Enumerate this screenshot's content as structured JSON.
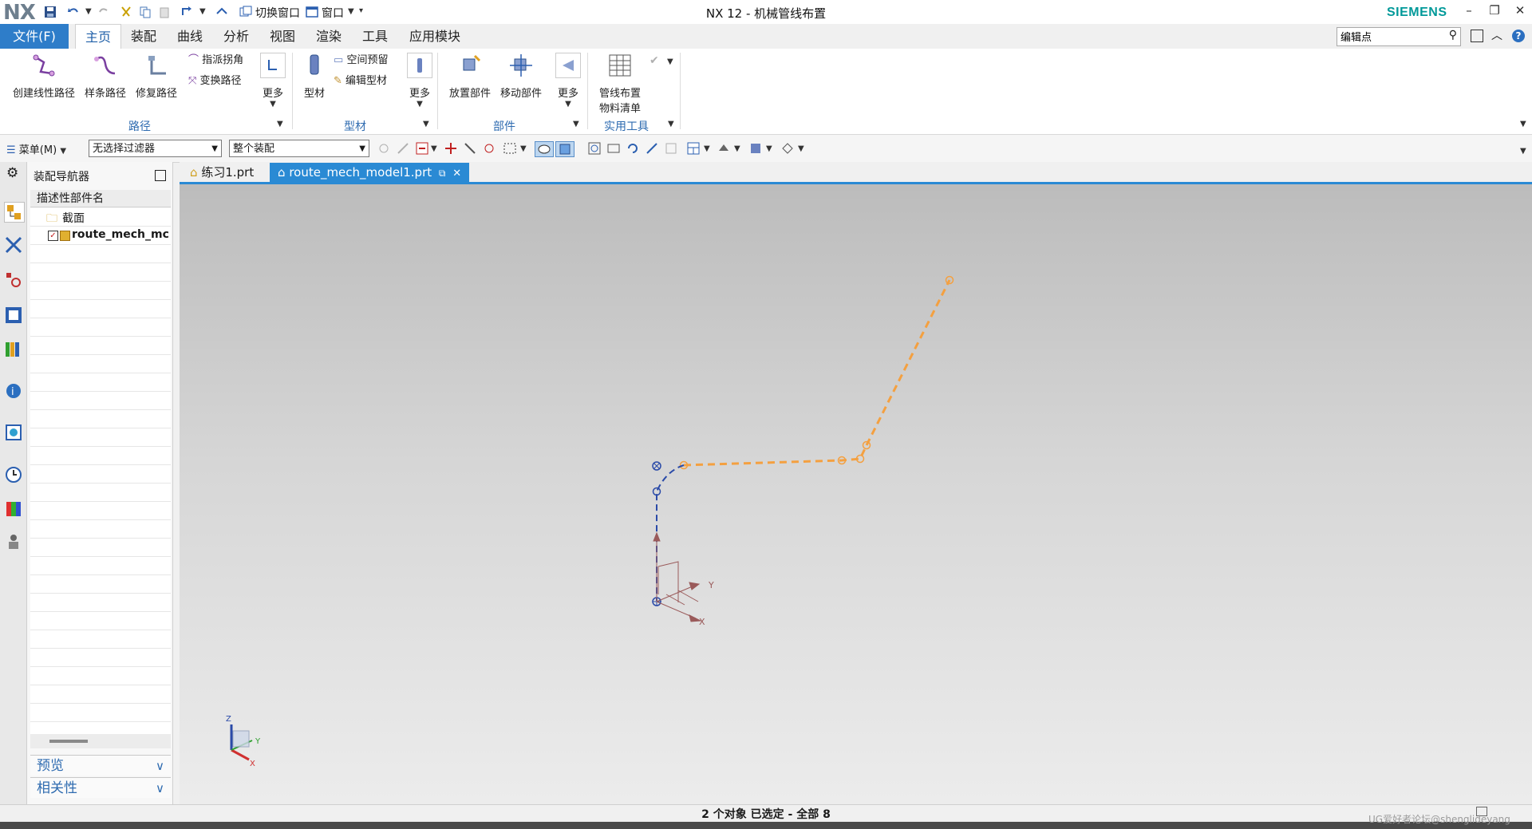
{
  "titlebar": {
    "logo": "NX",
    "title": "NX 12 - 机械管线布置",
    "brand": "SIEMENS",
    "switch_window": "切换窗口",
    "window_menu": "窗口"
  },
  "menu_tabs": {
    "file": "文件(F)",
    "items": [
      "主页",
      "装配",
      "曲线",
      "分析",
      "视图",
      "渲染",
      "工具",
      "应用模块"
    ]
  },
  "command_search": {
    "value": "编辑点"
  },
  "ribbon": {
    "path_group": {
      "label": "路径",
      "create_linear": "创建线性路径",
      "spline_path": "样条路径",
      "repair_path": "修复路径",
      "assign_corner": "指派拐角",
      "transform_path": "变换路径",
      "more": "更多"
    },
    "stock_group": {
      "label": "型材",
      "stock": "型材",
      "space_reserve": "空间预留",
      "edit_stock": "编辑型材",
      "more": "更多"
    },
    "part_group": {
      "label": "部件",
      "place_part": "放置部件",
      "move_part": "移动部件",
      "more": "更多"
    },
    "utility_group": {
      "label": "实用工具",
      "routing_list_line1": "管线布置",
      "routing_list_line2": "物料清单"
    }
  },
  "toolbar2": {
    "menu": "菜单(M)",
    "filter": "无选择过滤器",
    "scope": "整个装配"
  },
  "navigator": {
    "title": "装配导航器",
    "column": "描述性部件名",
    "rows": [
      {
        "label": "截面"
      },
      {
        "label": "route_mech_mc"
      }
    ],
    "preview": "预览",
    "dependencies": "相关性"
  },
  "doc_tabs": [
    "练习1.prt",
    "route_mech_model1.prt"
  ],
  "viewport": {
    "csys_labels": {
      "x": "X",
      "y": "Y"
    },
    "triad_labels": {
      "x": "X",
      "y": "Y",
      "z": "Z"
    },
    "colors": {
      "orange_path": "#f4a040",
      "blue_path": "#2a4aa8",
      "csys": "#9a5a5a"
    }
  },
  "status": {
    "text": "2 个对象 已选定 - 全部 8"
  },
  "watermark": "UG爱好者论坛@shenglideyang"
}
